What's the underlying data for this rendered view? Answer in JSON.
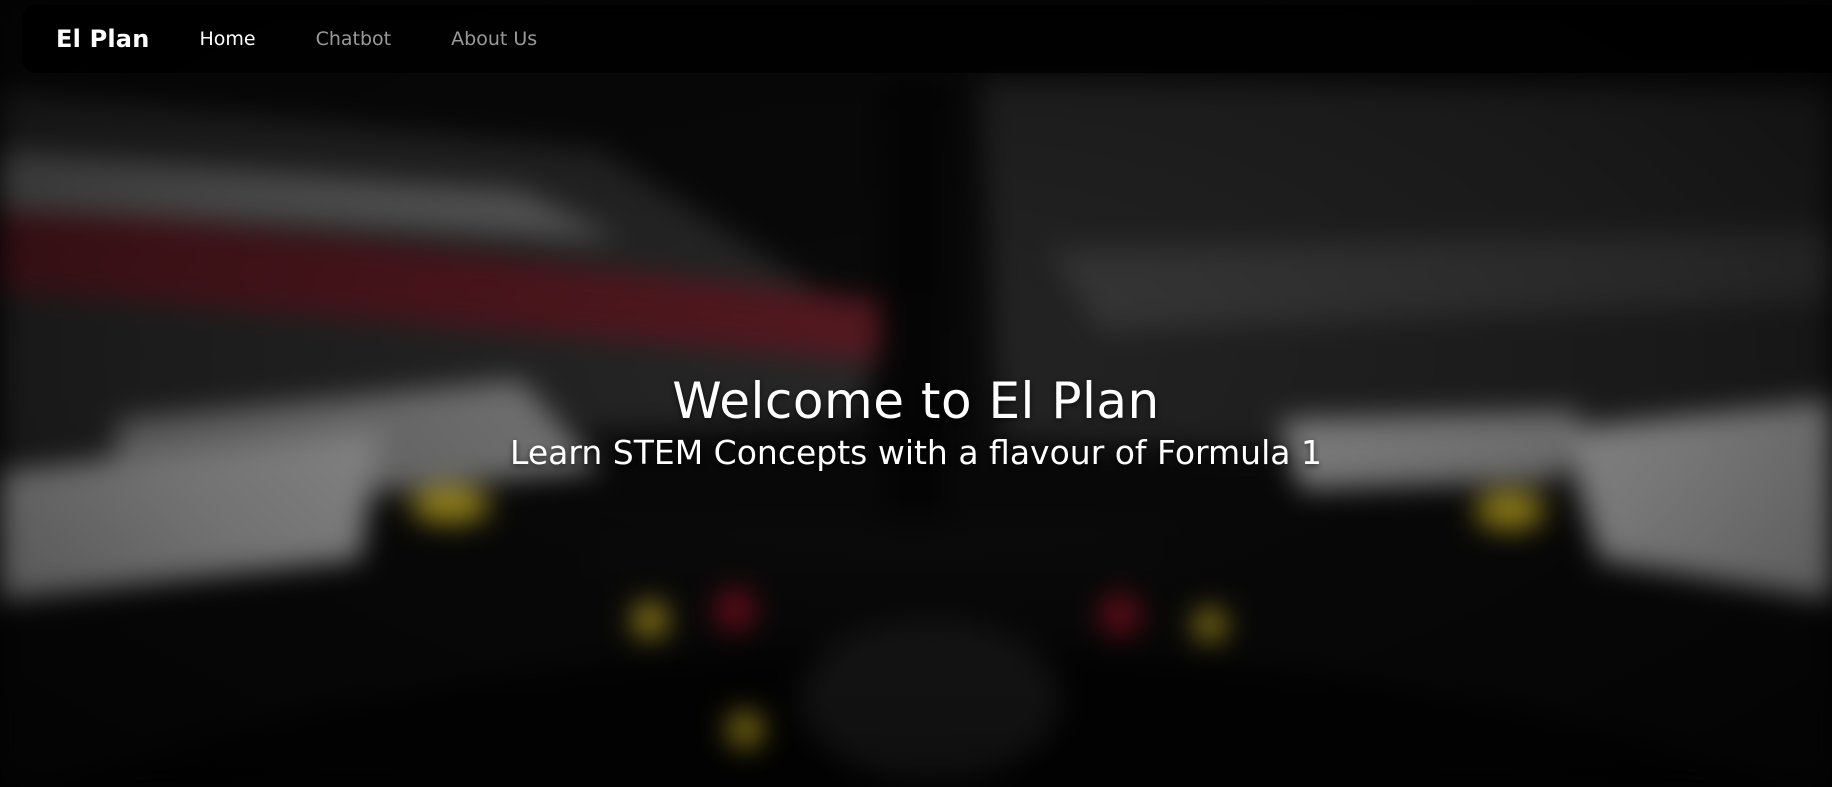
{
  "nav": {
    "brand": "El Plan",
    "links": [
      {
        "label": "Home",
        "active": true
      },
      {
        "label": "Chatbot",
        "active": false
      },
      {
        "label": "About Us",
        "active": false
      }
    ]
  },
  "hero": {
    "title": "Welcome to El Plan",
    "subtitle": "Learn STEM Concepts with a flavour of Formula 1"
  },
  "colors": {
    "nav_background": "#000000",
    "text_active": "#ffffff",
    "text_inactive": "#9a9a9a",
    "accent_red": "#8a1020",
    "accent_yellow": "#c9b020"
  }
}
